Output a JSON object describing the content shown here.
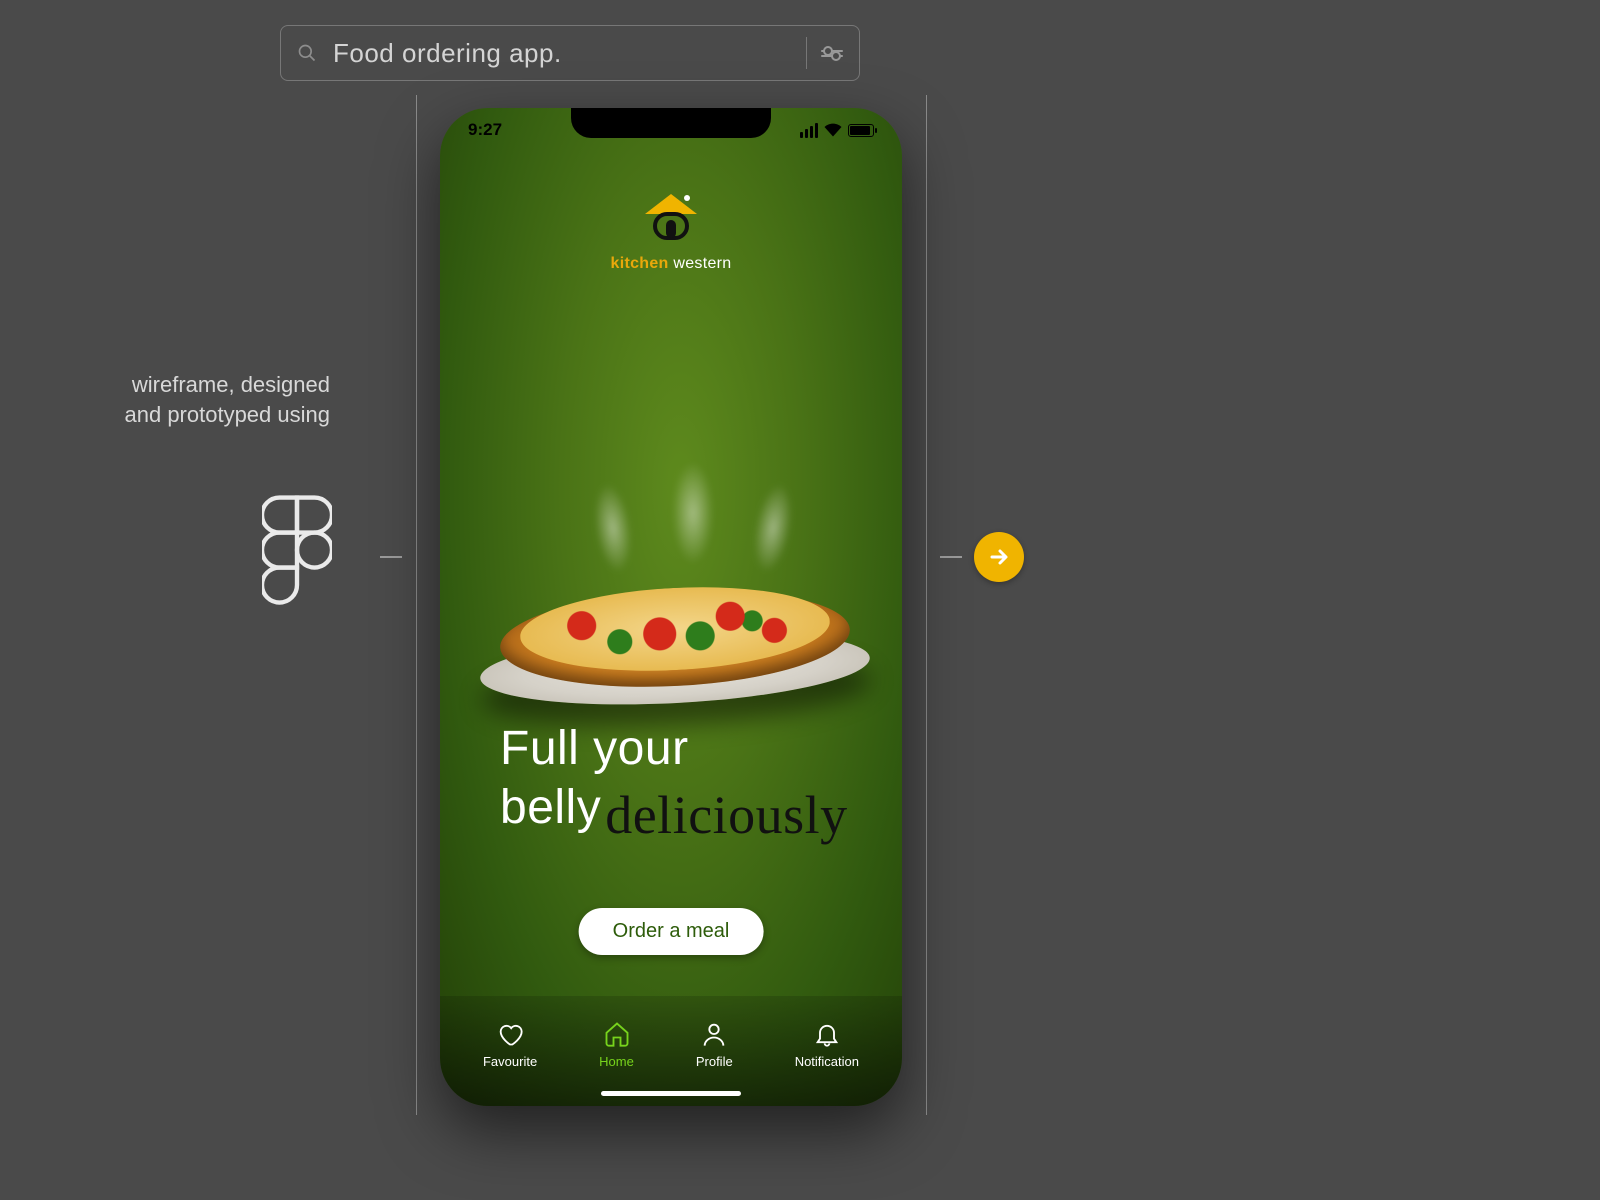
{
  "search": {
    "value": "Food ordering app."
  },
  "caption": "wireframe, designed and prototyped using",
  "phone": {
    "status_time": "9:27",
    "brand_strong": "kitchen",
    "brand_rest": " western",
    "headline_line1": "Full your",
    "headline_line2": "belly",
    "headline_script": "deliciously",
    "cta": "Order a meal",
    "nav": [
      {
        "label": "Favourite"
      },
      {
        "label": "Home"
      },
      {
        "label": "Profile"
      },
      {
        "label": "Notification"
      }
    ]
  }
}
